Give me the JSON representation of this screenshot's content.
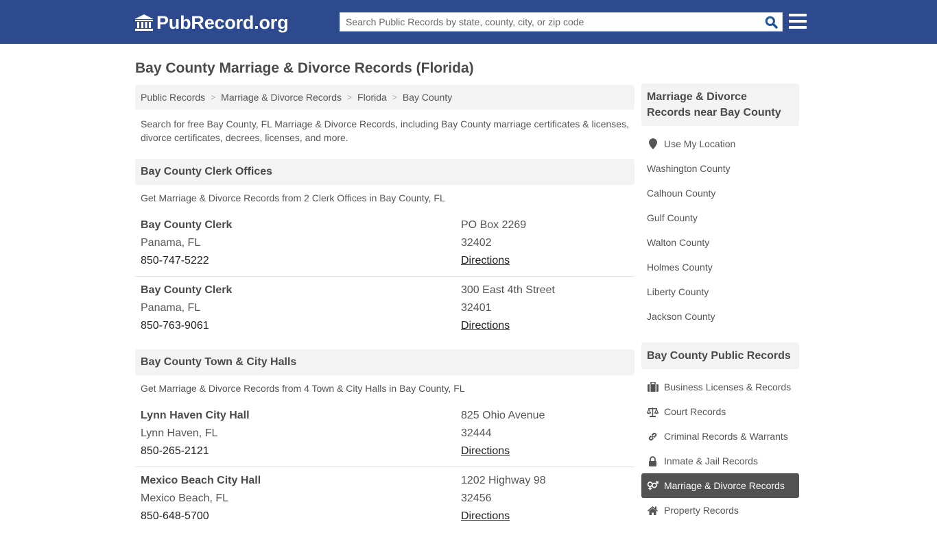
{
  "header": {
    "logo_text": "PubRecord.org",
    "search_placeholder": "Search Public Records by state, county, city, or zip code",
    "colors": {
      "brand": "#2c4a8d",
      "search_icon": "#1f5596"
    }
  },
  "page": {
    "title": "Bay County Marriage & Divorce Records (Florida)",
    "breadcrumb": [
      "Public Records",
      "Marriage & Divorce Records",
      "Florida",
      "Bay County"
    ],
    "intro": "Search for free Bay County, FL Marriage & Divorce Records, including Bay County marriage certificates & licenses, divorce certificates, decrees, licenses, and more."
  },
  "sections": [
    {
      "title": "Bay County Clerk Offices",
      "subtitle": "Get Marriage & Divorce Records from 2 Clerk Offices in Bay County, FL",
      "offices": [
        {
          "name": "Bay County Clerk",
          "city": "Panama, FL",
          "phone": "850-747-5222",
          "address": "PO Box 2269",
          "zip": "32402",
          "link": "Directions"
        },
        {
          "name": "Bay County Clerk",
          "city": "Panama, FL",
          "phone": "850-763-9061",
          "address": "300 East 4th Street",
          "zip": "32401",
          "link": "Directions"
        }
      ]
    },
    {
      "title": "Bay County Town & City Halls",
      "subtitle": "Get Marriage & Divorce Records from 4 Town & City Halls in Bay County, FL",
      "offices": [
        {
          "name": "Lynn Haven City Hall",
          "city": "Lynn Haven, FL",
          "phone": "850-265-2121",
          "address": "825 Ohio Avenue",
          "zip": "32444",
          "link": "Directions"
        },
        {
          "name": "Mexico Beach City Hall",
          "city": "Mexico Beach, FL",
          "phone": "850-648-5700",
          "address": "1202 Highway 98",
          "zip": "32456",
          "link": "Directions"
        }
      ]
    }
  ],
  "sidebar": {
    "nearby": {
      "title": "Marriage & Divorce Records near Bay County",
      "use_location": "Use My Location",
      "counties": [
        "Washington County",
        "Calhoun County",
        "Gulf County",
        "Walton County",
        "Holmes County",
        "Liberty County",
        "Jackson County"
      ]
    },
    "public_records": {
      "title": "Bay County Public Records",
      "items": [
        {
          "label": "Business Licenses & Records",
          "icon": "briefcase-icon"
        },
        {
          "label": "Court Records",
          "icon": "scales-icon"
        },
        {
          "label": "Criminal Records & Warrants",
          "icon": "link-icon"
        },
        {
          "label": "Inmate & Jail Records",
          "icon": "lock-icon"
        },
        {
          "label": "Marriage & Divorce Records",
          "icon": "gender-icon",
          "active": true
        },
        {
          "label": "Property Records",
          "icon": "home-icon"
        }
      ]
    }
  }
}
